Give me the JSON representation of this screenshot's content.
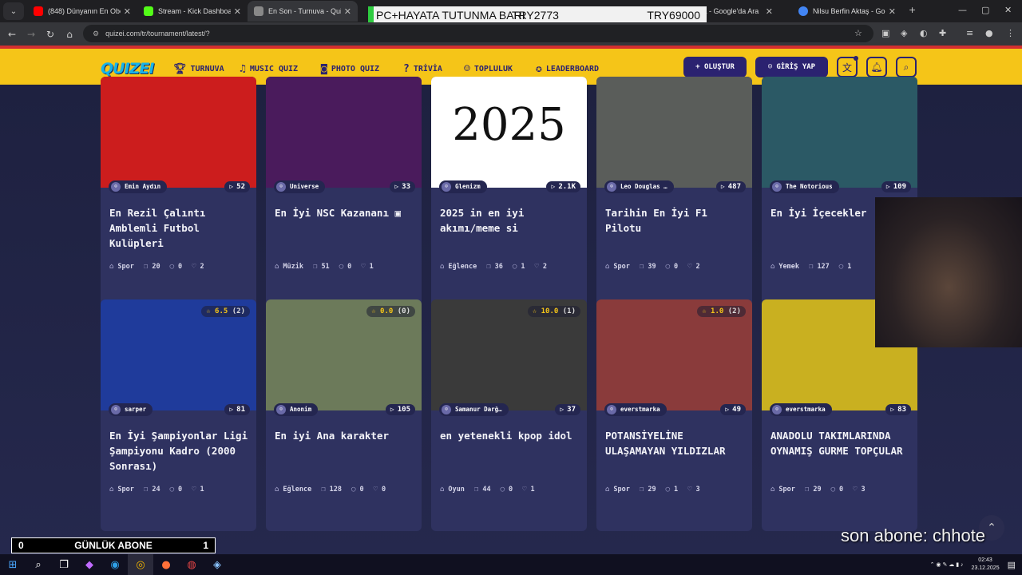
{
  "browser": {
    "tabs": [
      {
        "title": "(848) Dünyanın En Obez",
        "favicon_color": "#ff0000"
      },
      {
        "title": "Stream - Kick Dashboard",
        "favicon_color": "#53fc18"
      },
      {
        "title": "En Son - Turnuva - Quizei",
        "favicon_color": "#888888"
      },
      {
        "title": "",
        "favicon_color": "#999999"
      },
      {
        "title": "ua Lipa - Google'da Ara",
        "favicon_color": "#4285f4"
      },
      {
        "title": "Nilsu Berfin Aktaş - Goog",
        "favicon_color": "#4285f4"
      }
    ],
    "url": "quizei.com/tr/tournament/latest/?"
  },
  "stream_overlay": {
    "top_left": "PC+HAYATA TUTUNMA BARI",
    "top_mid": "TRY2773",
    "top_right": "TRY69000",
    "subs_left": "0",
    "subs_label": "GÜNLÜK ABONE",
    "subs_right": "1",
    "last_sub": "son abone: chhote"
  },
  "header": {
    "logo": "QUIZEI",
    "nav": [
      "TURNUVA",
      "MUSIC QUIZ",
      "PHOTO QUIZ",
      "TRİVİA",
      "TOPLULUK",
      "LEADERBOARD"
    ],
    "create": "+ OLUŞTUR",
    "login": "GİRİŞ YAP"
  },
  "cards": [
    {
      "author": "Emin Aydın",
      "plays": "52",
      "title": "En Rezil Çalıntı Amblemli Futbol Kulüpleri",
      "category": "Spor",
      "questions": "20",
      "comments": "0",
      "likes": "2",
      "rating": "",
      "thumb": "#cc1d1d"
    },
    {
      "author": "Universe",
      "plays": "33",
      "title": "En İyi NSC Kazananı ▣",
      "category": "Müzik",
      "questions": "51",
      "comments": "0",
      "likes": "1",
      "rating": "",
      "thumb": "#4a1b5c"
    },
    {
      "author": "Glenizm",
      "plays": "2.1K",
      "title": "2025 in en iyi akımı/meme si",
      "category": "Eğlence",
      "questions": "36",
      "comments": "1",
      "likes": "2",
      "rating": "",
      "thumb": "#ffffff",
      "thumb_text": "2025"
    },
    {
      "author": "Leo Douglas …",
      "plays": "487",
      "title": "Tarihin En İyi F1 Pilotu",
      "category": "Spor",
      "questions": "39",
      "comments": "0",
      "likes": "2",
      "rating": "",
      "thumb": "#5a5d5a"
    },
    {
      "author": "The Notorious",
      "plays": "109",
      "title": "En İyi İçecekler",
      "category": "Yemek",
      "questions": "127",
      "comments": "1",
      "likes": "",
      "rating": "",
      "thumb": "#2b5965"
    },
    {
      "author": "sarper",
      "plays": "81",
      "title": "En İyi Şampiyonlar Ligi Şampiyonu Kadro (2000 Sonrası)",
      "category": "Spor",
      "questions": "24",
      "comments": "0",
      "likes": "1",
      "rating": "6.5",
      "rating_count": "(2)",
      "thumb": "#1f3b9b"
    },
    {
      "author": "Anonim",
      "plays": "105",
      "title": "En iyi Ana karakter",
      "category": "Eğlence",
      "questions": "128",
      "comments": "0",
      "likes": "0",
      "rating": "0.0",
      "rating_count": "(0)",
      "thumb": "#6c7a5a"
    },
    {
      "author": "Samanur Darğ…",
      "plays": "37",
      "title": "en yetenekli kpop idol",
      "category": "Oyun",
      "questions": "44",
      "comments": "0",
      "likes": "1",
      "rating": "10.0",
      "rating_count": "(1)",
      "thumb": "#3a3a3a"
    },
    {
      "author": "everstmarka",
      "plays": "49",
      "title": "POTANSİYELİNE ULAŞAMAYAN YILDIZLAR",
      "category": "Spor",
      "questions": "29",
      "comments": "1",
      "likes": "3",
      "rating": "1.0",
      "rating_count": "(2)",
      "thumb": "#8a3b3b"
    },
    {
      "author": "everstmarka",
      "plays": "83",
      "title": "ANADOLU TAKIMLARINDA OYNAMIŞ GURME TOPÇULAR",
      "category": "Spor",
      "questions": "29",
      "comments": "0",
      "likes": "3",
      "rating": "",
      "thumb": "#c9b020"
    }
  ],
  "taskbar": {
    "time": "02:43",
    "date": "23.12.2025"
  }
}
